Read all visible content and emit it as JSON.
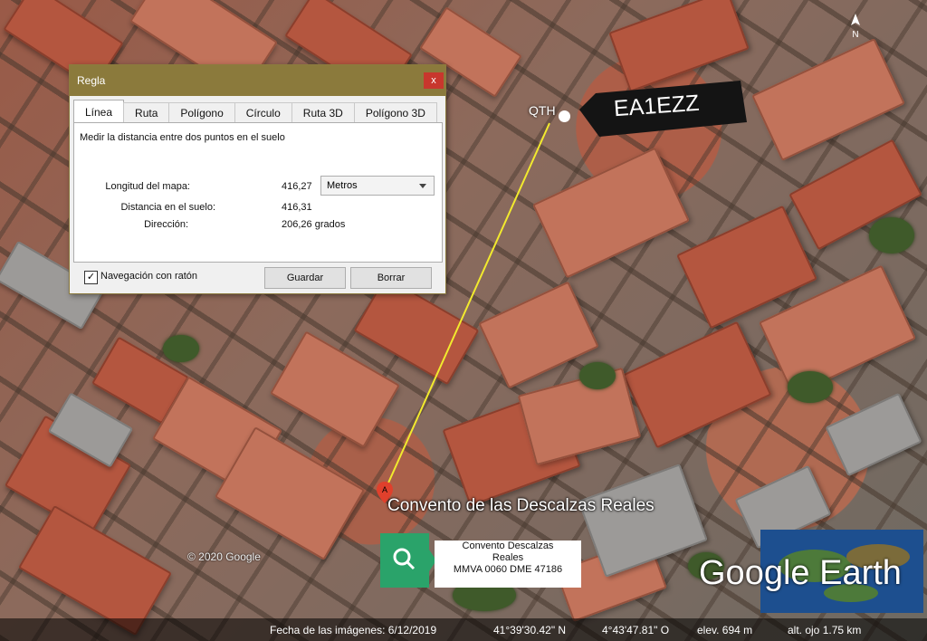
{
  "dialog": {
    "title": "Regla",
    "close_glyph": "x",
    "tabs": [
      {
        "label": "Línea",
        "active": true
      },
      {
        "label": "Ruta",
        "active": false
      },
      {
        "label": "Polígono",
        "active": false
      },
      {
        "label": "Círculo",
        "active": false
      },
      {
        "label": "Ruta 3D",
        "active": false
      },
      {
        "label": "Polígono 3D",
        "active": false
      }
    ],
    "description": "Medir la distancia entre dos puntos en el suelo",
    "map_length_label": "Longitud del mapa:",
    "map_length_value": "416,27",
    "unit_selected": "Metros",
    "ground_distance_label": "Distancia en el suelo:",
    "ground_distance_value": "416,31",
    "direction_label": "Dirección:",
    "direction_value": "206,26 grados",
    "mouse_nav_label": "Navegación con ratón",
    "mouse_nav_checked": true,
    "save_label": "Guardar",
    "clear_label": "Borrar"
  },
  "map": {
    "callsign": "EA1EZZ",
    "qth_label": "QTH",
    "place_label": "Convento de las Descalzas Reales",
    "pin_letter": "A",
    "search_card": {
      "line1": "Convento Descalzas",
      "line2": "Reales",
      "line3": "MMVA 0060 DME 47186"
    },
    "copyright": "© 2020 Google",
    "brand": "Google Earth",
    "compass_letter": "N"
  },
  "statusbar": {
    "imagery_date": "Fecha de las imágenes: 6/12/2019",
    "lat": "41°39'30.42\" N",
    "lon": "4°43'47.81\" O",
    "elev": "elev.   694 m",
    "eye_alt": "alt. ojo   1.75 km"
  },
  "colors": {
    "titlebar": "#8b7a3c",
    "measure_line": "#f2ea2e",
    "search_green": "#2aa36a",
    "pin_red": "#e0402c"
  }
}
